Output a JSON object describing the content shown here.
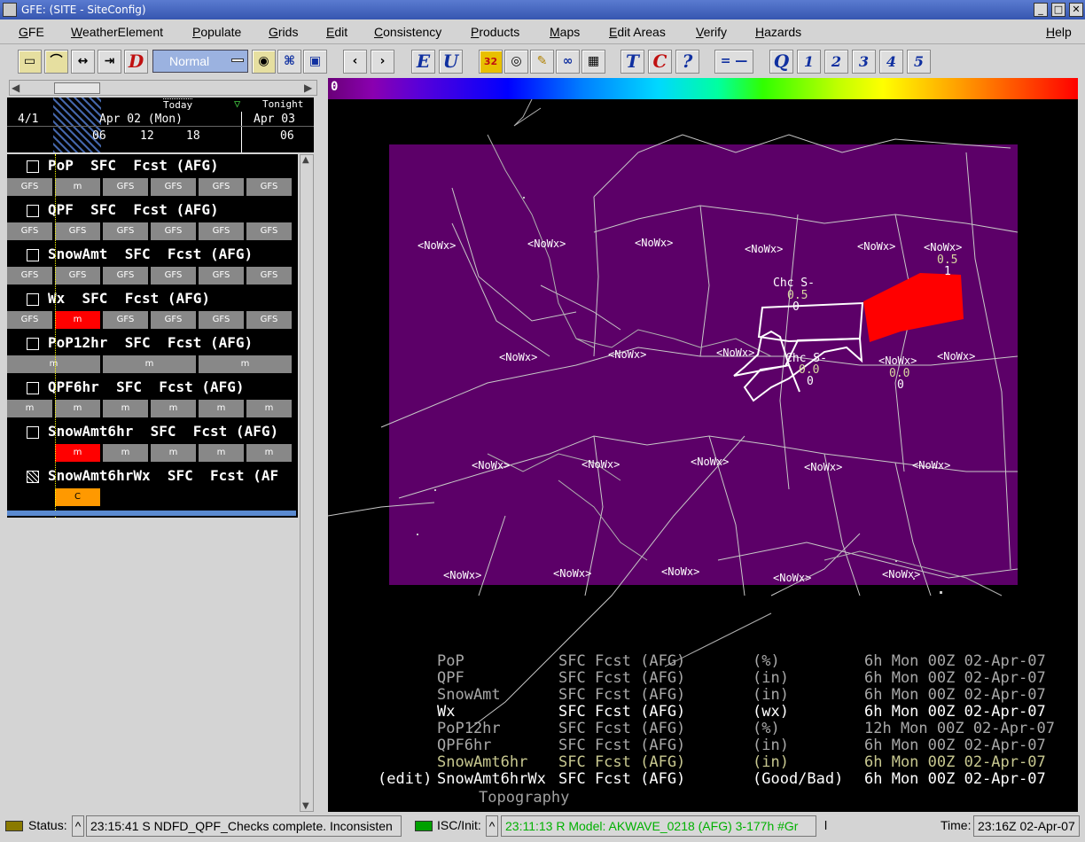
{
  "window": {
    "title": "GFE: (SITE - SiteConfig)"
  },
  "menu": [
    "GFE",
    "WeatherElement",
    "Populate",
    "Grids",
    "Edit",
    "Consistency",
    "Products",
    "Maps",
    "Edit Areas",
    "Verify",
    "Hazards",
    "Help"
  ],
  "toolbar": {
    "mode": "Normal",
    "buttons": [
      "D",
      "E",
      "U",
      "T",
      "C",
      "?",
      "Q",
      "1",
      "2",
      "3",
      "4",
      "5"
    ],
    "pixel_button": "32",
    "eq_label": "= —"
  },
  "timeline": {
    "prev_date": "4/1",
    "date": "Apr 02 (Mon)",
    "next_date": "Apr 03",
    "today": "Today",
    "tonight": "Tonight",
    "hours": [
      "06",
      "12",
      "18",
      "06"
    ]
  },
  "grids": [
    {
      "name": "PoP  SFC  Fcst (AFG)",
      "boxes": [
        "GFS",
        "m",
        "GFS",
        "GFS",
        "GFS",
        "GFS"
      ]
    },
    {
      "name": "QPF  SFC  Fcst (AFG)",
      "boxes": [
        "GFS",
        "GFS",
        "GFS",
        "GFS",
        "GFS",
        "GFS"
      ]
    },
    {
      "name": "SnowAmt  SFC  Fcst (AFG)",
      "boxes": [
        "GFS",
        "GFS",
        "GFS",
        "GFS",
        "GFS",
        "GFS"
      ]
    },
    {
      "name": "Wx  SFC  Fcst (AFG)",
      "boxes": [
        "GFS",
        "m",
        "GFS",
        "GFS",
        "GFS",
        "GFS"
      ]
    },
    {
      "name": "PoP12hr  SFC  Fcst (AFG)",
      "boxes": [
        "m",
        "m",
        "m"
      ]
    },
    {
      "name": "QPF6hr  SFC  Fcst (AFG)",
      "boxes": [
        "m",
        "m",
        "m",
        "m",
        "m",
        "m"
      ]
    },
    {
      "name": "SnowAmt6hr  SFC  Fcst (AFG)",
      "boxes": [
        "",
        "m",
        "m",
        "m",
        "m",
        "m"
      ]
    },
    {
      "name": "SnowAmt6hrWx  SFC  Fcst (AF",
      "boxes": [
        "C"
      ]
    }
  ],
  "colorbar": {
    "min_label": "0"
  },
  "map": {
    "nowx_label": "<NoWx>",
    "chc_label": "Chc S-",
    "labels_nowx": 19,
    "val_05": "0.5",
    "val_00": "0.0",
    "val_0": "0",
    "val_1": "1"
  },
  "legend": [
    {
      "prefix": "",
      "element": "PoP",
      "level": "SFC Fcst (AFG)",
      "unit": "(%)",
      "time": "6h Mon 00Z 02-Apr-07",
      "color": "#a8a8a8"
    },
    {
      "prefix": "",
      "element": "QPF",
      "level": "SFC Fcst (AFG)",
      "unit": "(in)",
      "time": "6h Mon 00Z 02-Apr-07",
      "color": "#a8a8a8"
    },
    {
      "prefix": "",
      "element": "SnowAmt",
      "level": "SFC Fcst (AFG)",
      "unit": "(in)",
      "time": "6h Mon 00Z 02-Apr-07",
      "color": "#a8a8a8"
    },
    {
      "prefix": "",
      "element": "Wx",
      "level": "SFC Fcst (AFG)",
      "unit": "(wx)",
      "time": "6h Mon 00Z 02-Apr-07",
      "color": "#ffffff"
    },
    {
      "prefix": "",
      "element": "PoP12hr",
      "level": "SFC Fcst (AFG)",
      "unit": "(%)",
      "time": "12h Mon 00Z 02-Apr-07",
      "color": "#a8a8a8"
    },
    {
      "prefix": "",
      "element": "QPF6hr",
      "level": "SFC Fcst (AFG)",
      "unit": "(in)",
      "time": "6h Mon 00Z 02-Apr-07",
      "color": "#a8a8a8"
    },
    {
      "prefix": "",
      "element": "SnowAmt6hr",
      "level": "SFC Fcst (AFG)",
      "unit": "(in)",
      "time": "6h Mon 00Z 02-Apr-07",
      "color": "#c8c890"
    },
    {
      "prefix": "(edit)",
      "element": "SnowAmt6hrWx",
      "level": "SFC Fcst (AFG)",
      "unit": "(Good/Bad)",
      "time": "6h Mon 00Z 02-Apr-07",
      "color": "#ffffff"
    }
  ],
  "topography": "Topography",
  "status": {
    "label": "Status:",
    "message": "23:15:41 S NDFD_QPF_Checks complete. Inconsisten",
    "isc_label": "ISC/Init:",
    "isc_message": "23:11:13 R Model: AKWAVE_0218 (AFG) 3-177h #Gr",
    "isc_rest": "l",
    "time_label": "Time:",
    "time_value": "23:16Z 02-Apr-07"
  }
}
